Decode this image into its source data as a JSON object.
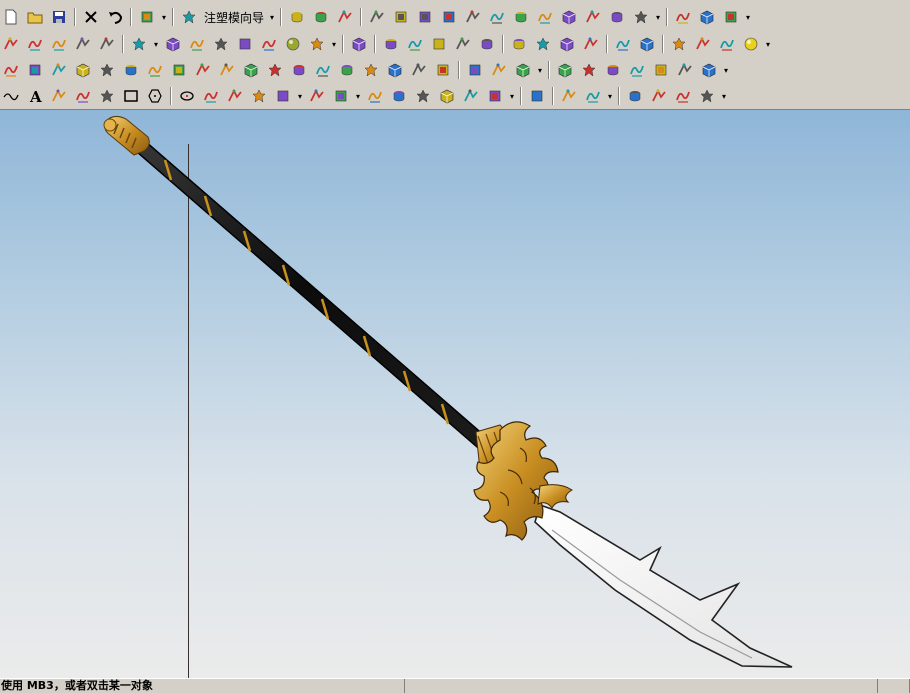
{
  "toolbar": {
    "mold_wizard_label": "注塑模向导",
    "dropdown_glyph": "▾",
    "row1": [
      "new-file-icon",
      "open-file-icon",
      "save-icon",
      "|",
      "close-x-icon",
      "undo-icon",
      "|",
      "edit-pencil-icon",
      "drop",
      "|",
      "mold-tool-icon",
      "MOLD",
      "drop",
      "|",
      "layer-sheets-icon",
      "layer-stack-icon",
      "layer-stack-2-icon",
      "|",
      "sketch-point-icon",
      "sketch-arrow-icon",
      "sketch-axis-icon",
      "sketch-curve-icon",
      "sketch-dim-icon",
      "sketch-fork-icon",
      "sketch-fix-icon",
      "sketch-pattern-icon",
      "sketch-fan-icon",
      "sketch-plus-icon",
      "sketch-shield-icon",
      "sketch-stack-icon",
      "drop",
      "|",
      "settings-gear-icon",
      "settings-gear-2-icon",
      "eraser-icon",
      "drop"
    ],
    "row2": [
      "zoom-icon",
      "rotate-icon",
      "pan-icon",
      "frame-icon",
      "axes-icon",
      "|",
      "cube-solid-icon",
      "drop",
      "cube-blue-icon",
      "cube-blue-2-icon",
      "cube-wire-icon",
      "cube-wire-2-icon",
      "cube-wire-3-icon",
      "sphere-icon",
      "view-square-icon",
      "drop",
      "|",
      "layout-icon",
      "|",
      "feature-1-icon",
      "feature-2-icon",
      "feature-3-icon",
      "feature-4-icon",
      "cube-cut-icon",
      "|",
      "sketch-a-icon",
      "sketch-b-icon",
      "sketch-c-icon",
      "sketch-d-icon",
      "|",
      "box-icon",
      "cylinder-icon",
      "|",
      "block-icon",
      "cylinder-2-icon",
      "cone-icon",
      "ball-icon",
      "drop"
    ],
    "row3": [
      "surface-1-icon",
      "surface-2-icon",
      "surface-3-icon",
      "surface-4-icon",
      "surface-5-icon",
      "surface-6-icon",
      "surface-7-icon",
      "surface-8-icon",
      "surface-9-icon",
      "surface-10-icon",
      "surface-11-icon",
      "surface-12-icon",
      "surface-13-icon",
      "surface-14-icon",
      "surface-15-icon",
      "surface-16-icon",
      "surface-17-icon",
      "surface-18-icon",
      "surface-19-icon",
      "|",
      "body-1-icon",
      "body-2-icon",
      "body-3-icon",
      "drop",
      "|",
      "analyze-1-icon",
      "analyze-2-icon",
      "analyze-3-icon",
      "analyze-4-icon",
      "analyze-5-icon",
      "analyze-6-icon",
      "analyze-7-icon",
      "drop"
    ],
    "row4": [
      "curve-wave-icon",
      "text-a-icon",
      "point-set-icon",
      "points-icon",
      "corner-icon",
      "rectangle-icon",
      "hexagon-icon",
      "|",
      "ellipse-icon",
      "spiral-icon",
      "xyz-icon",
      "blob-icon",
      "fork-icon",
      "drop",
      "curve-a-icon",
      "curve-b-icon",
      "drop",
      "curve-c-icon",
      "curve-d-icon",
      "curve-e-icon",
      "curve-f-icon",
      "curve-g-icon",
      "curve-h-icon",
      "drop",
      "|",
      "assembly-icon",
      "|",
      "constraint-icon",
      "pen-icon",
      "drop",
      "|",
      "measure-icon",
      "angle-icon",
      "draft-icon",
      "grade-icon",
      "drop"
    ]
  },
  "status": {
    "prompt": "使用 MB3，或者双击某一对象",
    "middle": "",
    "end": ""
  },
  "colors": {
    "viewport_top": "#8fb6d8",
    "viewport_bottom": "#ebebeb",
    "shaft": "#121212",
    "gold": "#d9a232",
    "blade": "#f4f4f4"
  }
}
